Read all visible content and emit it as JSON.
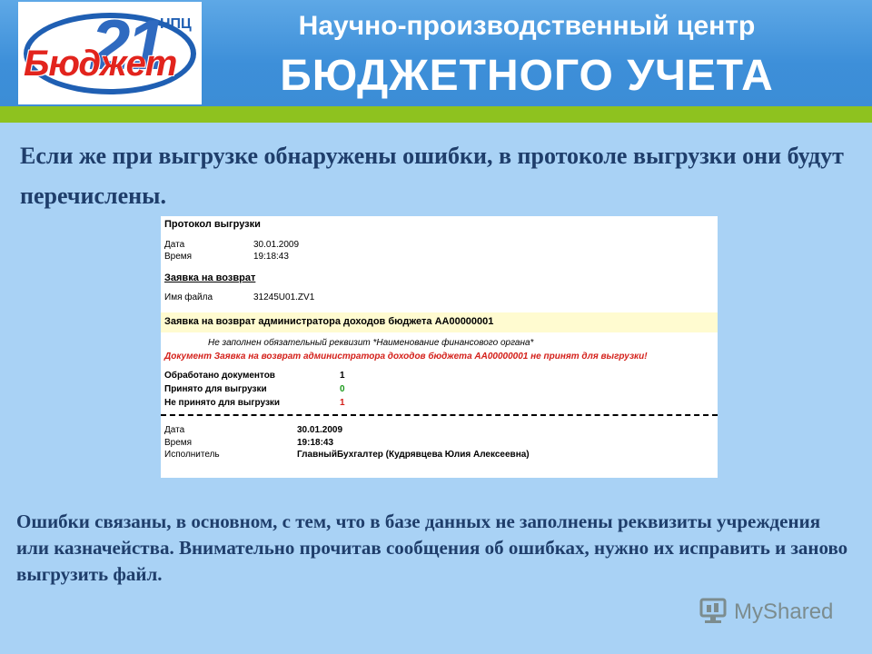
{
  "header": {
    "logo": {
      "npc": "НПЦ",
      "number": "21",
      "word": "Бюджет"
    },
    "title_line1": "Научно-производственный центр",
    "title_line2": "БЮДЖЕТНОГО УЧЕТА"
  },
  "intro_text": "Если же при выгрузке обнаружены ошибки, в протоколе выгрузки они будут перечислены.",
  "protocol": {
    "title": "Протокол выгрузки",
    "date_label": "Дата",
    "date_value": "30.01.2009",
    "time_label": "Время",
    "time_value": "19:18:43",
    "section_title": "Заявка на возврат",
    "file_label": "Имя файла",
    "file_value": "31245U01.ZV1",
    "doc_header": "Заявка на возврат администратора доходов бюджета АА00000001",
    "warning": "Не заполнен обязательный реквизит *Наименование финансового органа*",
    "error": "Документ Заявка на возврат администратора доходов бюджета АА00000001 не принят для выгрузки!",
    "processed_label": "Обработано документов",
    "processed_value": "1",
    "accepted_label": "Принято для выгрузки",
    "accepted_value": "0",
    "rejected_label": "Не принято для выгрузки",
    "rejected_value": "1",
    "footer_date_label": "Дата",
    "footer_date_value": "30.01.2009",
    "footer_time_label": "Время",
    "footer_time_value": "19:18:43",
    "executor_label": "Исполнитель",
    "executor_value": "ГлавныйБухгалтер (Кудрявцева Юлия Алексеевна)"
  },
  "footer_text": "Ошибки связаны, в основном, с тем, что в базе данных не заполнены реквизиты учреждения или казначейства. Внимательно прочитав сообщения об ошибках, нужно их исправить и заново выгрузить файл.",
  "watermark": "MyShared",
  "colors": {
    "header_blue": "#3d8fd9",
    "green_bar": "#8ec21f",
    "background": "#a9d2f5",
    "text_navy": "#1f3e6b",
    "error_red": "#d4201a"
  }
}
